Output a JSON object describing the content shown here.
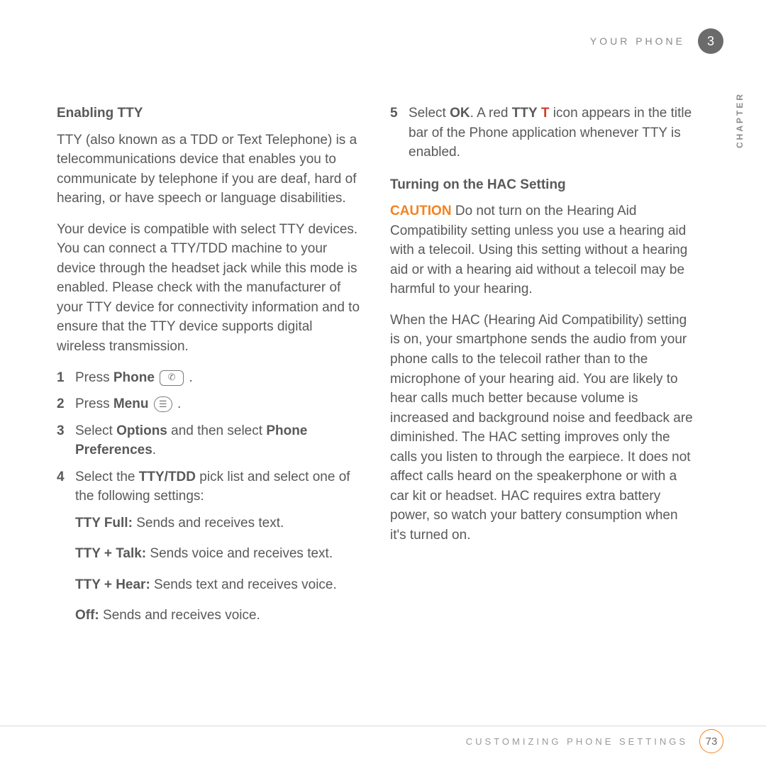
{
  "header": {
    "section": "YOUR PHONE",
    "chapter_num": "3",
    "chapter_word": "CHAPTER"
  },
  "footer": {
    "section": "CUSTOMIZING PHONE SETTINGS",
    "page": "73"
  },
  "left": {
    "h1": "Enabling TTY",
    "p1": "TTY (also known as a TDD or Text Telephone) is a telecommunications device that enables you to communicate by telephone if you are deaf, hard of hearing, or have speech or language disabilities.",
    "p2": "Your device is compatible with select TTY devices. You can connect a TTY/TDD machine to your device through the headset jack while this mode is enabled. Please check with the manufacturer of your TTY device for connectivity information and to ensure that the TTY device supports digital wireless transmission.",
    "s1a": "Press ",
    "s1b": "Phone",
    "s1c": " .",
    "s2a": "Press ",
    "s2b": "Menu",
    "s2c": " .",
    "s3a": "Select ",
    "s3b": "Options",
    "s3c": " and then select ",
    "s3d": "Phone Preferences",
    "s3e": ".",
    "s4a": "Select the ",
    "s4b": "TTY/TDD",
    "s4c": " pick list and select one of the following settings:",
    "opt1a": "TTY Full:",
    "opt1b": " Sends and receives text.",
    "opt2a": "TTY + Talk:",
    "opt2b": " Sends voice and receives text.",
    "opt3a": "TTY + Hear:",
    "opt3b": " Sends text and receives voice.",
    "opt4a": "Off:",
    "opt4b": " Sends and receives voice."
  },
  "right": {
    "s5a": "Select ",
    "s5b": "OK",
    "s5c": ". A red ",
    "s5d": "TTY",
    "s5e": " ",
    "s5f": "T",
    "s5g": " icon appears in the title bar of the Phone application whenever TTY is enabled.",
    "h2": "Turning on the HAC Setting",
    "caution_label": "CAUTION",
    "caution_body": "  Do not turn on the Hearing Aid Compatibility setting unless you use a hearing aid with a telecoil. Using this setting without a hearing aid or with a hearing aid without a telecoil may be harmful to your hearing.",
    "p3": "When the HAC (Hearing Aid Compatibility) setting is on, your smartphone sends the audio from your phone calls to the telecoil rather than to the microphone of your hearing aid. You are likely to hear calls much better because volume is increased and background noise and feedback are diminished. The HAC setting improves only the calls you listen to through the earpiece. It does not affect calls heard on the speakerphone or with a car kit or headset. HAC requires extra battery power, so watch your battery consumption when it's turned on."
  },
  "nums": {
    "n1": "1",
    "n2": "2",
    "n3": "3",
    "n4": "4",
    "n5": "5"
  },
  "icons": {
    "phone": "✆",
    "menu": "☰"
  }
}
